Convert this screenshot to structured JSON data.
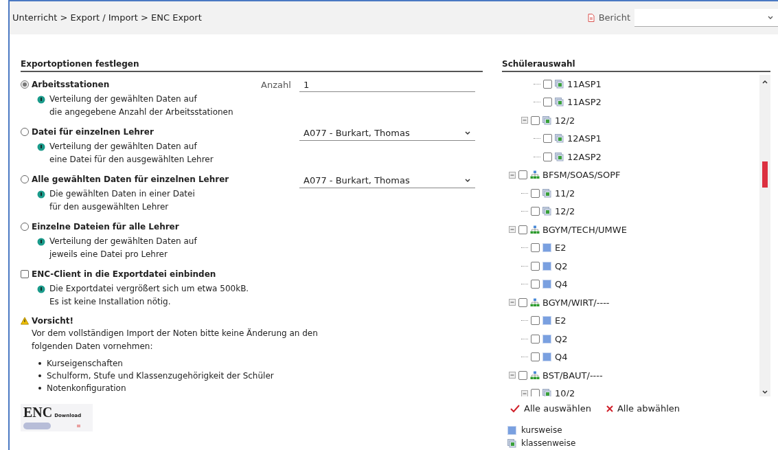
{
  "breadcrumb": "Unterricht > Export / Import > ENC Export",
  "report": {
    "label": "Bericht"
  },
  "export_options": {
    "title": "Exportoptionen festlegen",
    "options": [
      {
        "kind": "radio",
        "label": "Arbeitsstationen",
        "selected": true,
        "info": [
          "Verteilung der gewählten Daten auf",
          "die angegebene Anzahl der Arbeitsstationen"
        ],
        "field": {
          "kind": "text",
          "label": "Anzahl",
          "value": "1"
        }
      },
      {
        "kind": "radio",
        "label": "Datei für einzelnen Lehrer",
        "selected": false,
        "info": [
          "Verteilung der gewählten Daten auf",
          "eine Datei für den ausgewählten Lehrer"
        ],
        "field": {
          "kind": "select",
          "value": "A077 - Burkart, Thomas"
        }
      },
      {
        "kind": "radio",
        "label": "Alle gewählten Daten für einzelnen Lehrer",
        "selected": false,
        "info": [
          "Die gewählten Daten in einer Datei",
          "für den ausgewählten Lehrer"
        ],
        "field": {
          "kind": "select",
          "value": "A077 - Burkart, Thomas"
        }
      },
      {
        "kind": "radio",
        "label": "Einzelne Dateien für alle Lehrer",
        "selected": false,
        "info": [
          "Verteilung der gewählten Daten auf",
          "jeweils eine Datei pro Lehrer"
        ]
      },
      {
        "kind": "checkbox",
        "label": "ENC-Client in die Exportdatei einbinden",
        "checked": false,
        "info": [
          "Die Exportdatei vergrößert sich um etwa 500kB.",
          "Es ist keine Installation nötig."
        ]
      }
    ],
    "warning": {
      "title": "Vorsicht!",
      "text": [
        "Vor dem vollständigen Import der Noten bitte keine Änderung an den",
        "folgenden Daten vornehmen:"
      ],
      "items": [
        "Kurseigenschaften",
        "Schulform, Stufe und Klassenzugehörigkeit der Schüler",
        "Notenkonfiguration"
      ]
    },
    "download_logo": {
      "title": "ENC",
      "subtitle": "Download"
    }
  },
  "student_selection": {
    "title": "Schülerauswahl",
    "tree": [
      {
        "children": [
          {
            "children": [
              {
                "kind": "class",
                "label": "11ASP1",
                "checked": false
              },
              {
                "kind": "class",
                "label": "11ASP2",
                "checked": false
              }
            ]
          },
          {
            "kind": "class",
            "label": "12/2",
            "checked": false,
            "expanded": true,
            "children": [
              {
                "kind": "class",
                "label": "12ASP1",
                "checked": false
              },
              {
                "kind": "class",
                "label": "12ASP2",
                "checked": false
              }
            ]
          }
        ]
      },
      {
        "kind": "group",
        "label": "BFSM/SOAS/SOPF",
        "checked": false,
        "expanded": true,
        "children": [
          {
            "kind": "class",
            "label": "11/2",
            "checked": false
          },
          {
            "kind": "class",
            "label": "12/2",
            "checked": false
          }
        ]
      },
      {
        "kind": "group",
        "label": "BGYM/TECH/UMWE",
        "checked": false,
        "expanded": true,
        "children": [
          {
            "kind": "course",
            "label": "E2",
            "checked": false
          },
          {
            "kind": "course",
            "label": "Q2",
            "checked": false
          },
          {
            "kind": "course",
            "label": "Q4",
            "checked": false
          }
        ]
      },
      {
        "kind": "group",
        "label": "BGYM/WIRT/----",
        "checked": false,
        "expanded": true,
        "children": [
          {
            "kind": "course",
            "label": "E2",
            "checked": false
          },
          {
            "kind": "course",
            "label": "Q2",
            "checked": false
          },
          {
            "kind": "course",
            "label": "Q4",
            "checked": false
          }
        ]
      },
      {
        "kind": "group",
        "label": "BST/BAUT/----",
        "checked": false,
        "expanded": true,
        "children": [
          {
            "kind": "class",
            "label": "10/2",
            "checked": false,
            "expanded": true
          }
        ]
      }
    ],
    "actions": [
      {
        "kind": "select_all",
        "label": "Alle auswählen"
      },
      {
        "kind": "deselect_all",
        "label": "Alle abwählen"
      }
    ],
    "legend": [
      {
        "kind": "course",
        "label": "kursweise"
      },
      {
        "kind": "class",
        "label": "klassenweise"
      }
    ]
  }
}
